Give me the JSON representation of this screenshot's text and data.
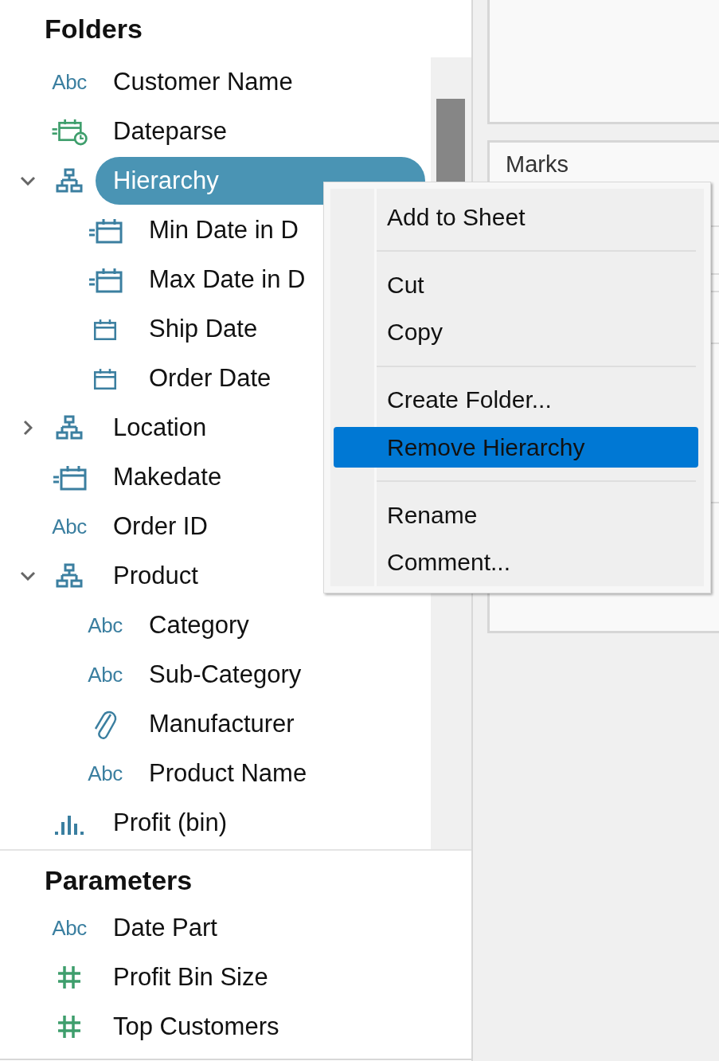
{
  "folders": {
    "title": "Folders",
    "items": [
      {
        "kind": "string",
        "icon_text": "Abc",
        "label": "Customer Name",
        "selected": false
      },
      {
        "kind": "calc-datetime",
        "label": "Dateparse",
        "selected": false
      },
      {
        "kind": "hierarchy",
        "label": "Hierarchy",
        "selected": true,
        "expanded": true,
        "children": [
          {
            "kind": "calc-date",
            "label": "Min Date in D",
            "selected": false
          },
          {
            "kind": "calc-date",
            "label": "Max Date in D",
            "selected": false
          },
          {
            "kind": "date",
            "label": "Ship Date",
            "selected": false
          },
          {
            "kind": "date",
            "label": "Order Date",
            "selected": false
          }
        ]
      },
      {
        "kind": "hierarchy",
        "label": "Location",
        "selected": false,
        "expanded": false
      },
      {
        "kind": "calc-date",
        "label": "Makedate",
        "selected": false
      },
      {
        "kind": "string",
        "icon_text": "Abc",
        "label": "Order ID",
        "selected": false
      },
      {
        "kind": "hierarchy",
        "label": "Product",
        "selected": false,
        "expanded": true,
        "children": [
          {
            "kind": "string",
            "icon_text": "Abc",
            "label": "Category",
            "selected": false
          },
          {
            "kind": "string",
            "icon_text": "Abc",
            "label": "Sub-Category",
            "selected": false
          },
          {
            "kind": "attachment",
            "label": "Manufacturer",
            "selected": false
          },
          {
            "kind": "string",
            "icon_text": "Abc",
            "label": "Product Name",
            "selected": false
          }
        ]
      },
      {
        "kind": "bin",
        "label": "Profit (bin)",
        "selected": false
      }
    ]
  },
  "parameters": {
    "title": "Parameters",
    "items": [
      {
        "kind": "string",
        "icon_text": "Abc",
        "label": "Date Part",
        "selected": false
      },
      {
        "kind": "number",
        "label": "Profit Bin Size",
        "selected": false
      },
      {
        "kind": "number",
        "label": "Top Customers",
        "selected": false
      }
    ]
  },
  "marks_card": {
    "title": "Marks"
  },
  "context_menu": {
    "groups": [
      [
        {
          "label": "Add to Sheet",
          "selected": false
        }
      ],
      [
        {
          "label": "Cut",
          "selected": false
        },
        {
          "label": "Copy",
          "selected": false
        }
      ],
      [
        {
          "label": "Create Folder...",
          "selected": false
        },
        {
          "label": "Remove Hierarchy",
          "selected": true
        }
      ],
      [
        {
          "label": "Rename",
          "selected": false
        },
        {
          "label": "Comment...",
          "selected": false
        }
      ]
    ]
  }
}
